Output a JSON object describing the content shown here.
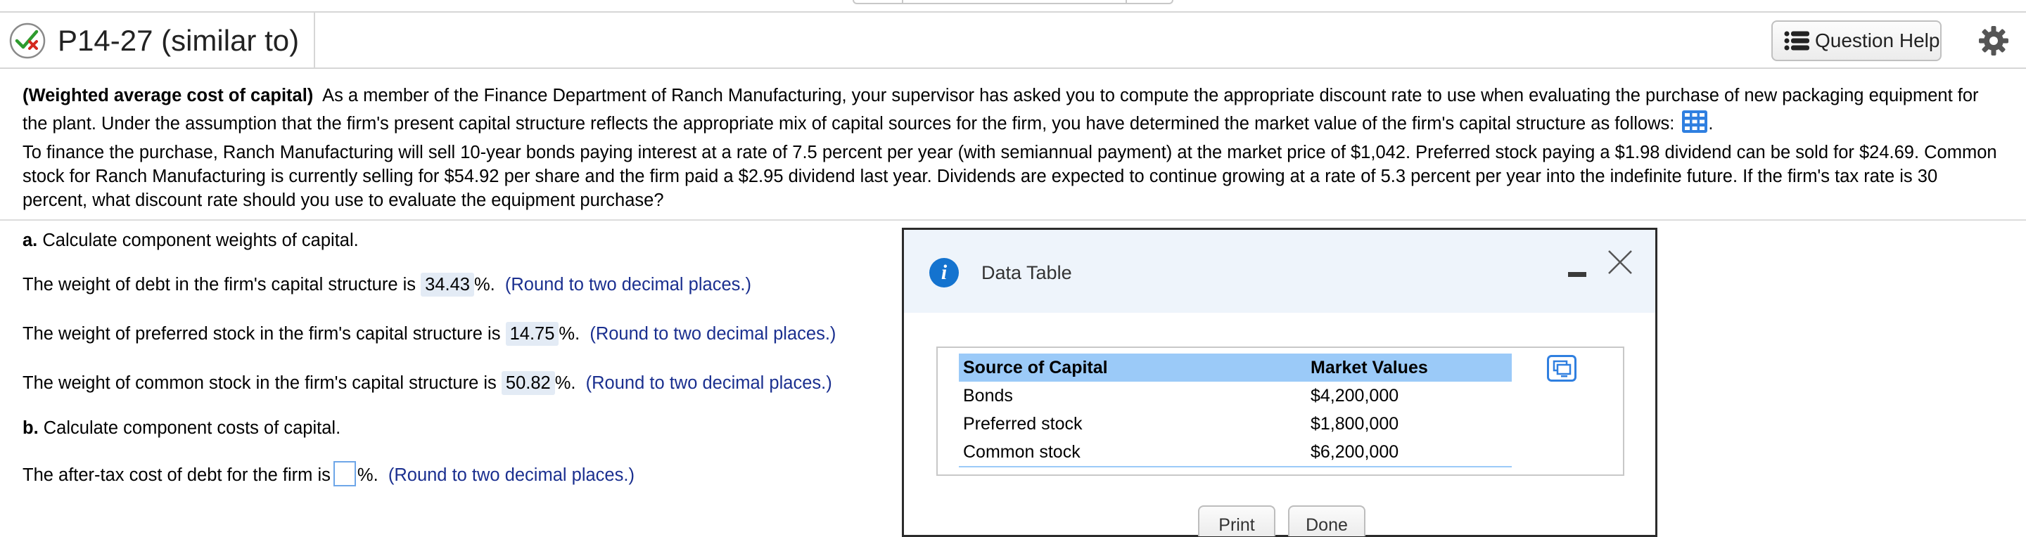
{
  "header": {
    "problem_title": "P14-27 (similar to)",
    "question_help_label": "Question Help",
    "status_icon": "check-x-icon",
    "settings_icon": "gear-icon"
  },
  "question": {
    "title_bold": "(Weighted average cost of capital)",
    "para1": "As a member of the Finance Department of Ranch Manufacturing, your supervisor has asked you to compute the appropriate discount rate to use when evaluating the purchase of new packaging equipment for the plant.  Under the assumption that the firm's present capital structure reflects the appropriate mix of capital sources for the firm, you have determined the market value of the firm's capital structure as follows:",
    "para1_end": ".",
    "para2": "To finance the purchase, Ranch Manufacturing will sell 10-year bonds paying interest at a rate of 7.5 percent per year (with semiannual payment) at the market price of $1,042.  Preferred stock paying a $1.98 dividend can be sold for $24.69.  Common stock for Ranch Manufacturing is currently selling for $54.92 per share and the firm paid a $2.95 dividend last year.  Dividends are expected to continue growing at a rate of 5.3 percent per year into the indefinite future.  If the firm's tax rate is 30 percent, what discount rate should you use to evaluate the equipment purchase?"
  },
  "parts": {
    "a_letter": "a.",
    "a_text": "Calculate component weights of capital.",
    "debt_prefix": "The weight of debt in the firm's capital structure is",
    "debt_value": "34.43",
    "debt_suffix": "%.",
    "debt_hint": "(Round to two decimal places.)",
    "pref_prefix": "The weight of preferred stock in the firm's capital structure is",
    "pref_value": "14.75",
    "pref_suffix": "%.",
    "pref_hint": "(Round to two decimal places.)",
    "common_prefix": "The weight of common stock in the firm's capital structure is",
    "common_value": "50.82",
    "common_suffix": "%.",
    "common_hint": "(Round to two decimal places.)",
    "b_letter": "b.",
    "b_text": "Calculate component costs of capital.",
    "aftertax_prefix": "The after-tax cost of debt for the firm is",
    "aftertax_value": "",
    "aftertax_suffix": "%.",
    "aftertax_hint": "(Round to two decimal places.)"
  },
  "dialog": {
    "title": "Data Table",
    "columns": [
      "Source of Capital",
      "Market Values"
    ],
    "rows": [
      [
        "Bonds",
        "$4,200,000"
      ],
      [
        "Preferred stock",
        "$1,800,000"
      ],
      [
        "Common stock",
        "$6,200,000"
      ]
    ],
    "print_label": "Print",
    "done_label": "Done"
  },
  "colors": {
    "accent_blue": "#1473cf",
    "table_header": "#9bcaf8",
    "answer_fill": "#e3ebf5",
    "hint_text": "#1a2f8f"
  }
}
